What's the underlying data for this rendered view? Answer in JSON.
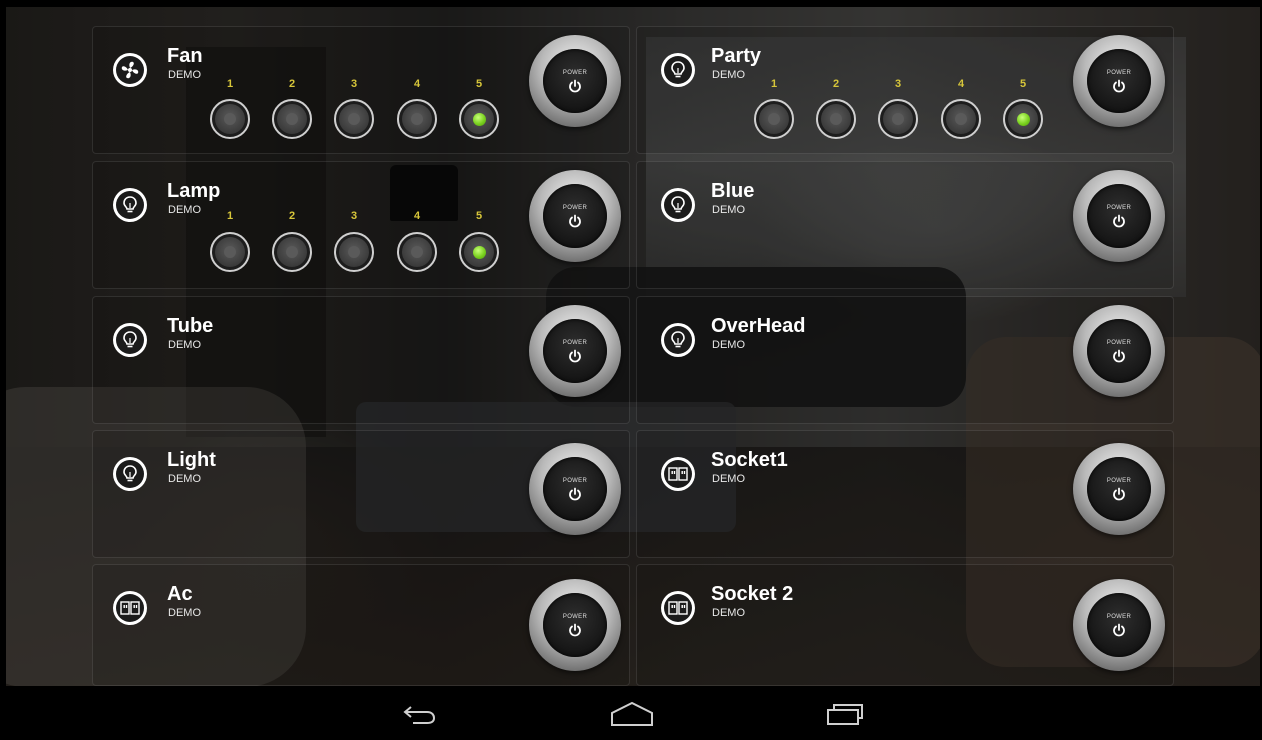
{
  "level_labels": [
    "1",
    "2",
    "3",
    "4",
    "5"
  ],
  "power_label": "POWER",
  "devices": [
    {
      "name": "Fan",
      "sub": "DEMO",
      "icon": "fan-icon",
      "active_level": 5
    },
    {
      "name": "Party",
      "sub": "DEMO",
      "icon": "bulb-icon",
      "active_level": 5
    },
    {
      "name": "Lamp",
      "sub": "DEMO",
      "icon": "bulb-icon",
      "active_level": 5
    },
    {
      "name": "Blue",
      "sub": "DEMO",
      "icon": "bulb-icon"
    },
    {
      "name": "Tube",
      "sub": "DEMO",
      "icon": "bulb-icon"
    },
    {
      "name": "OverHead",
      "sub": "DEMO",
      "icon": "bulb-icon"
    },
    {
      "name": "Light",
      "sub": "DEMO",
      "icon": "bulb-icon"
    },
    {
      "name": "Socket1",
      "sub": "DEMO",
      "icon": "socket-icon"
    },
    {
      "name": "Ac",
      "sub": "DEMO",
      "icon": "socket-icon"
    },
    {
      "name": "Socket 2",
      "sub": "DEMO",
      "icon": "socket-icon"
    }
  ],
  "navbar": {
    "back": "back-icon",
    "home": "home-icon",
    "recents": "recents-icon"
  },
  "colors": {
    "led_on": "#7ad11f",
    "level_number": "#d7c63a"
  }
}
